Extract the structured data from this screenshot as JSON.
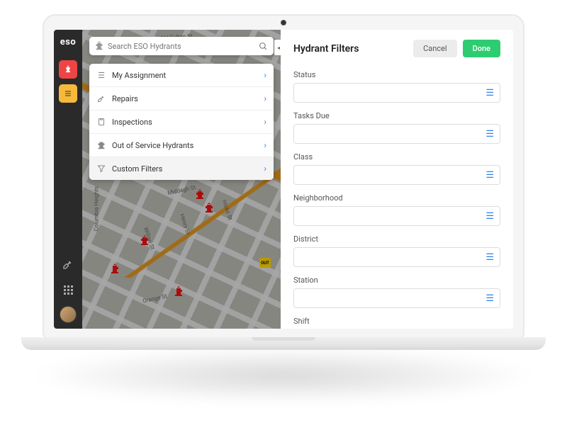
{
  "brand": "eso",
  "search": {
    "placeholder": "Search ESO Hydrants"
  },
  "menu": {
    "items": [
      {
        "icon": "list",
        "label": "My Assignment"
      },
      {
        "icon": "wrench",
        "label": "Repairs"
      },
      {
        "icon": "clipboard",
        "label": "Inspections"
      },
      {
        "icon": "hydrant-off",
        "label": "Out of Service Hydrants"
      },
      {
        "icon": "funnel",
        "label": "Custom Filters"
      }
    ]
  },
  "map": {
    "streets": [
      "Old Fulton St",
      "Middagh St",
      "Hicks St",
      "Henry St",
      "Orange St",
      "Columbia Heights",
      "Willow St"
    ],
    "out_marker_label": "OUT"
  },
  "filters": {
    "title": "Hydrant Filters",
    "cancel": "Cancel",
    "done": "Done",
    "fields": [
      {
        "label": "Status"
      },
      {
        "label": "Tasks Due"
      },
      {
        "label": "Class"
      },
      {
        "label": "Neighborhood"
      },
      {
        "label": "District"
      },
      {
        "label": "Station"
      },
      {
        "label": "Shift"
      }
    ]
  }
}
